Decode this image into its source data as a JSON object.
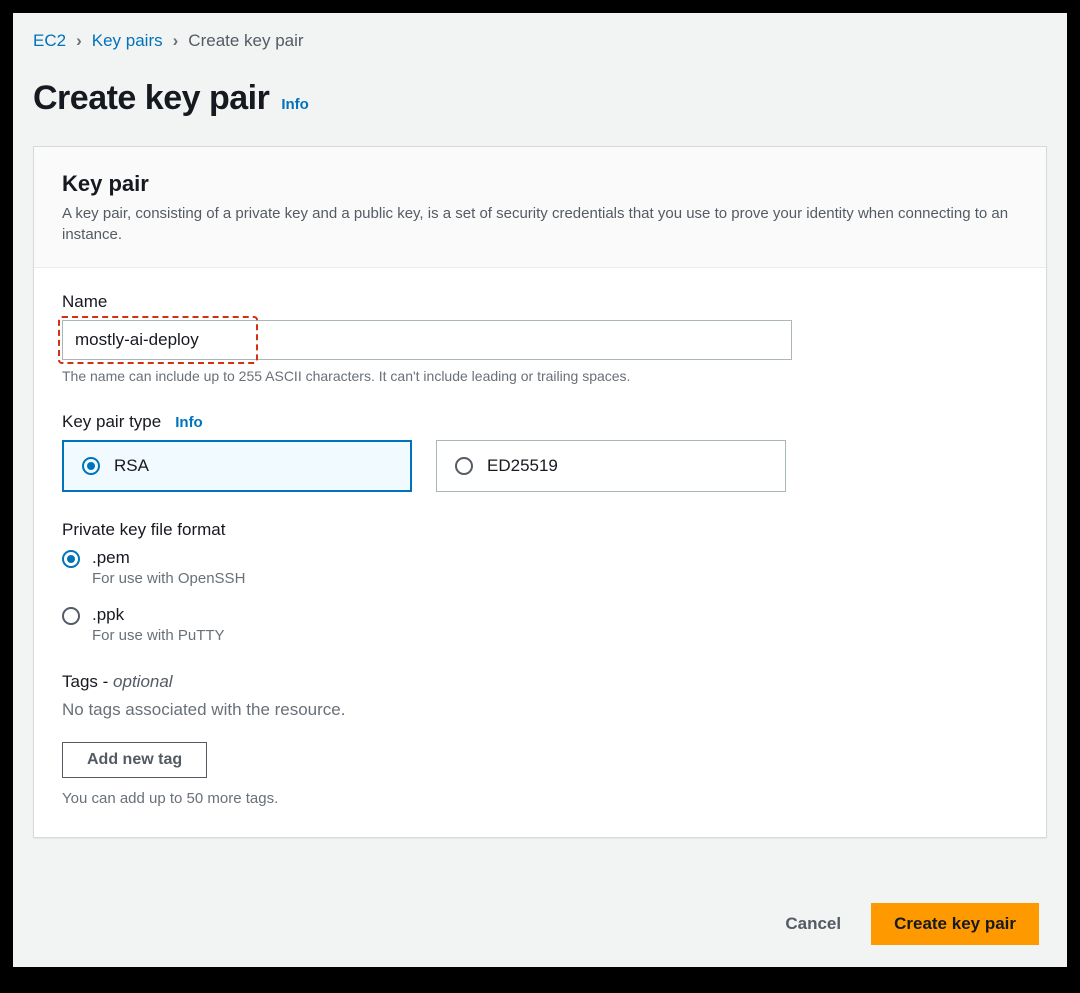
{
  "breadcrumb": {
    "root": "EC2",
    "parent": "Key pairs",
    "current": "Create key pair"
  },
  "page": {
    "title": "Create key pair",
    "info": "Info"
  },
  "panel": {
    "title": "Key pair",
    "description": "A key pair, consisting of a private key and a public key, is a set of security credentials that you use to prove your identity when connecting to an instance."
  },
  "name_field": {
    "label": "Name",
    "value": "mostly-ai-deploy",
    "hint": "The name can include up to 255 ASCII characters. It can't include leading or trailing spaces."
  },
  "type_field": {
    "label": "Key pair type",
    "info": "Info",
    "options": [
      {
        "label": "RSA",
        "selected": true
      },
      {
        "label": "ED25519",
        "selected": false
      }
    ]
  },
  "format_field": {
    "label": "Private key file format",
    "options": [
      {
        "label": ".pem",
        "sub": "For use with OpenSSH",
        "selected": true
      },
      {
        "label": ".ppk",
        "sub": "For use with PuTTY",
        "selected": false
      }
    ]
  },
  "tags": {
    "header": "Tags - ",
    "optional": "optional",
    "none": "No tags associated with the resource.",
    "add_btn": "Add new tag",
    "hint": "You can add up to 50 more tags."
  },
  "footer": {
    "cancel": "Cancel",
    "create": "Create key pair"
  }
}
